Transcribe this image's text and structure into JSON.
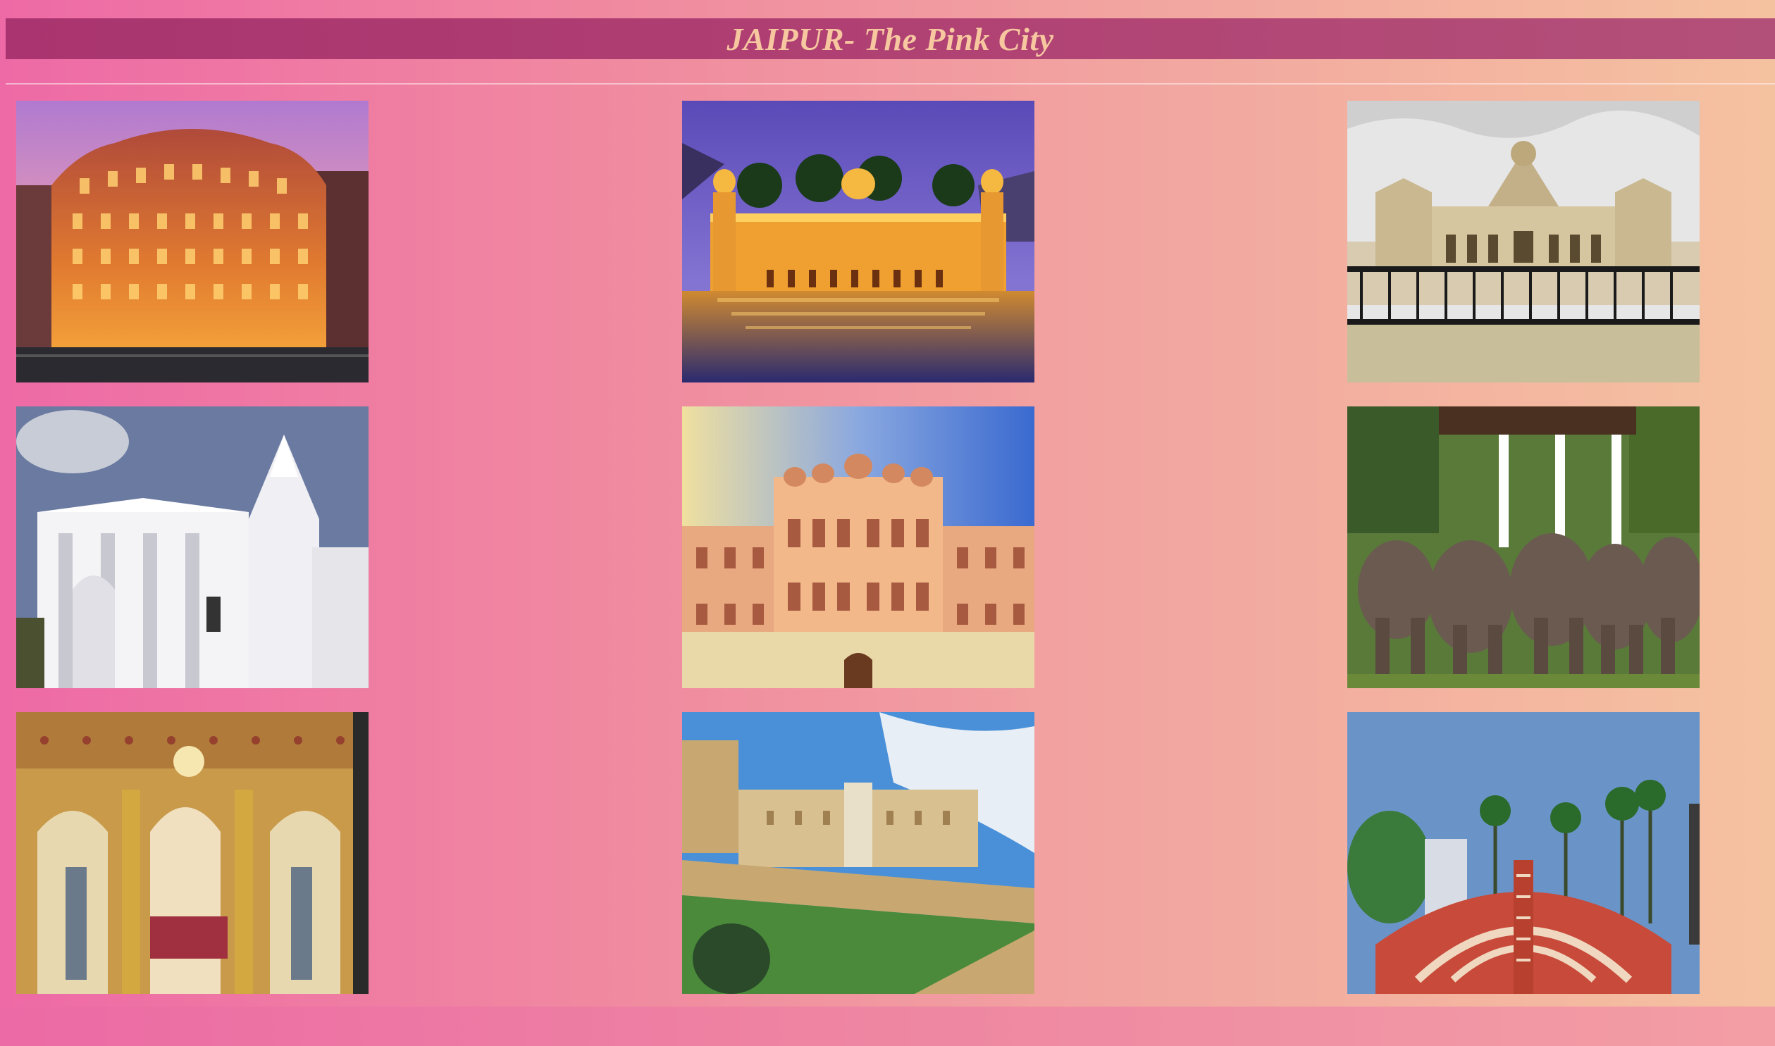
{
  "header": {
    "title": "JAIPUR- The Pink City"
  },
  "gallery": {
    "images": [
      {
        "name": "hawa-mahal-night-image",
        "icon": "palace-facade-icon"
      },
      {
        "name": "jal-mahal-image",
        "icon": "water-palace-icon"
      },
      {
        "name": "albert-hall-museum-image",
        "icon": "museum-building-icon"
      },
      {
        "name": "birla-mandir-image",
        "icon": "white-temple-icon"
      },
      {
        "name": "city-palace-image",
        "icon": "palace-facade-icon"
      },
      {
        "name": "elephant-festival-image",
        "icon": "elephants-icon"
      },
      {
        "name": "sheesh-mahal-interior-image",
        "icon": "ornate-interior-icon"
      },
      {
        "name": "amber-fort-image",
        "icon": "hill-fort-icon"
      },
      {
        "name": "jantar-mantar-image",
        "icon": "observatory-icon"
      }
    ]
  },
  "colors": {
    "background_left": "#ee6aa6",
    "background_right": "#f5c2a0",
    "header_bar": "#a9346f",
    "header_text": "#f7c7a0"
  }
}
